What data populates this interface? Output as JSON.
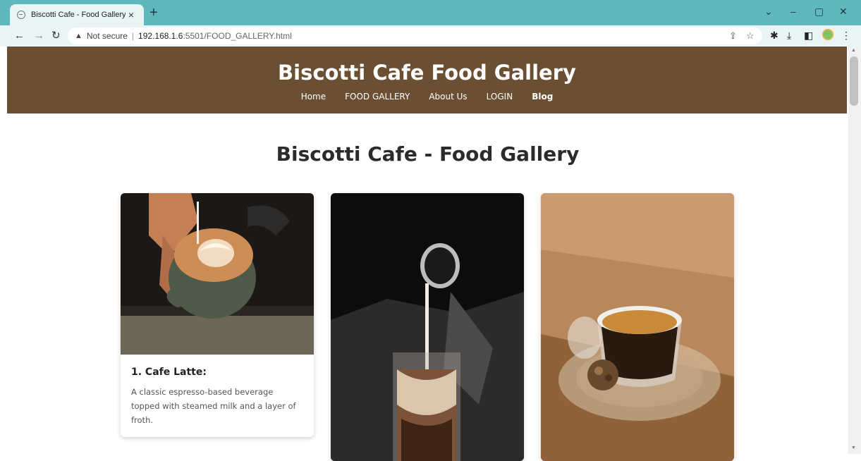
{
  "browser": {
    "tab_title": "Biscotti Cafe - Food Gallery",
    "tab_close": "×",
    "new_tab": "+",
    "not_secure": "Not secure",
    "url_host": "192.168.1.6",
    "url_path": ":5501/FOOD_GALLERY.html",
    "icons": [
      "back-icon",
      "forward-icon",
      "reload-icon",
      "warning-icon",
      "share-icon",
      "star-icon",
      "extensions-icon",
      "download-icon",
      "sidepanel-icon",
      "profile-icon",
      "menu-icon"
    ]
  },
  "header": {
    "title": "Biscotti Cafe Food Gallery",
    "nav": [
      "Home",
      "FOOD GALLERY",
      "About Us",
      "LOGIN",
      "Blog"
    ]
  },
  "main": {
    "heading": "Biscotti Cafe - Food Gallery",
    "cards": [
      {
        "title": "1. Cafe Latte:",
        "description": "A classic espresso-based beverage topped with steamed milk and a layer of froth."
      }
    ]
  },
  "colors": {
    "chrome_tabbar": "#5fb8bd",
    "header_bg": "#6b4f33",
    "text": "#2b2b2b"
  }
}
